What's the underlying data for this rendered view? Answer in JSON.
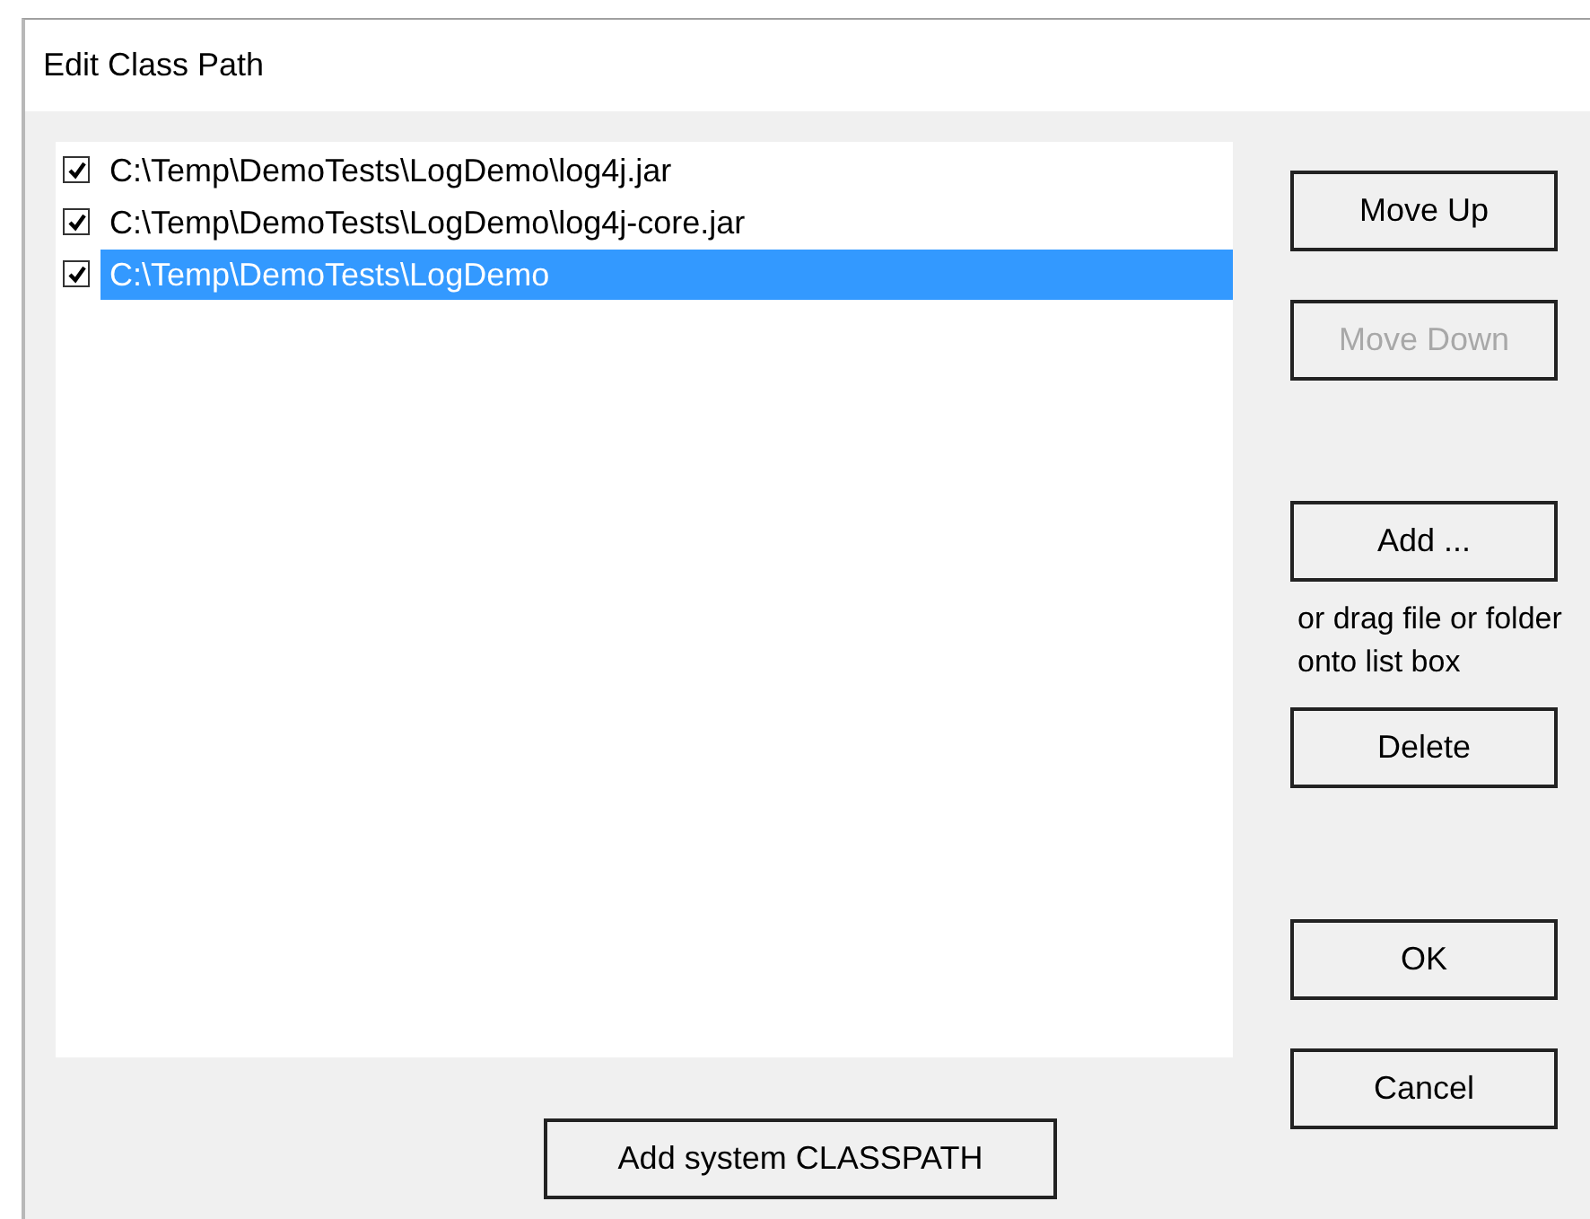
{
  "window": {
    "title": "Edit Class Path"
  },
  "list": [
    {
      "path": "C:\\Temp\\DemoTests\\LogDemo\\log4j.jar",
      "checked": true,
      "selected": false
    },
    {
      "path": "C:\\Temp\\DemoTests\\LogDemo\\log4j-core.jar",
      "checked": true,
      "selected": false
    },
    {
      "path": "C:\\Temp\\DemoTests\\LogDemo",
      "checked": true,
      "selected": true
    }
  ],
  "side": [
    {
      "kind": "button",
      "label": "Move Up",
      "disabled": false
    },
    {
      "kind": "button",
      "label": "Move Down",
      "disabled": true
    },
    {
      "kind": "button",
      "label": "Add ...",
      "disabled": false
    },
    {
      "kind": "hint",
      "text": "or drag file or folder onto list box"
    },
    {
      "kind": "button",
      "label": "Delete",
      "disabled": false
    },
    {
      "kind": "button",
      "label": "OK",
      "disabled": false
    },
    {
      "kind": "button",
      "label": "Cancel",
      "disabled": false
    }
  ],
  "bottom_button": {
    "label": "Add system CLASSPATH",
    "disabled": false
  }
}
